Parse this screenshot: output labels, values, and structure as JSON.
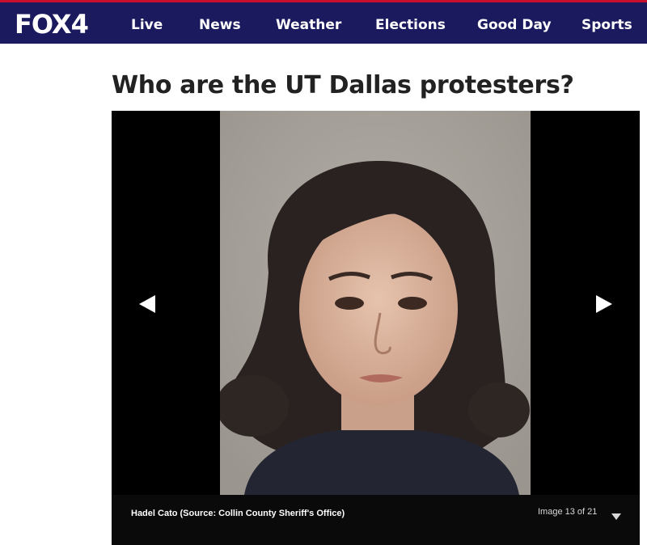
{
  "header": {
    "logo_text": "FOX4",
    "nav": [
      "Live",
      "News",
      "Weather",
      "Elections",
      "Good Day",
      "Sports"
    ]
  },
  "article": {
    "headline": "Who are the UT Dallas protesters?"
  },
  "gallery": {
    "caption": "Hadel Cato (Source: Collin County Sheriff's Office)",
    "counter": "Image 13 of 21",
    "prev_icon": "left-triangle-arrow",
    "next_icon": "right-triangle-arrow",
    "counter_toggle_icon": "chevron-down-triangle"
  },
  "colors": {
    "header_bg": "#1c1a5e",
    "header_accent": "#c8102e",
    "gallery_bg": "#000000"
  }
}
